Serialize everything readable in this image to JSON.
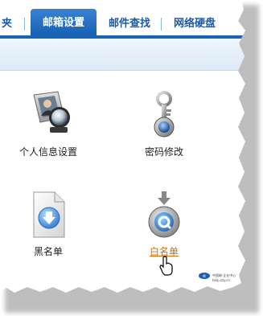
{
  "nav": {
    "tabs": [
      {
        "label": "夹"
      },
      {
        "label": "邮箱设置"
      },
      {
        "label": "邮件查找"
      },
      {
        "label": "网络硬盘"
      }
    ]
  },
  "tiles": [
    {
      "label": "个人信息设置",
      "icon": "address-book-icon"
    },
    {
      "label": "密码修改",
      "icon": "key-icon"
    },
    {
      "label": "黑名单",
      "icon": "document-download-icon"
    },
    {
      "label": "白名单",
      "icon": "quicktime-download-icon"
    }
  ],
  "footer": {
    "logo_line1": "中国邮·企业中心",
    "logo_line2": "help.zzy.cn"
  },
  "colors": {
    "tab_active": "#1a64b8",
    "tab_text": "#1a5ba6",
    "link_hover": "#d96b00"
  }
}
